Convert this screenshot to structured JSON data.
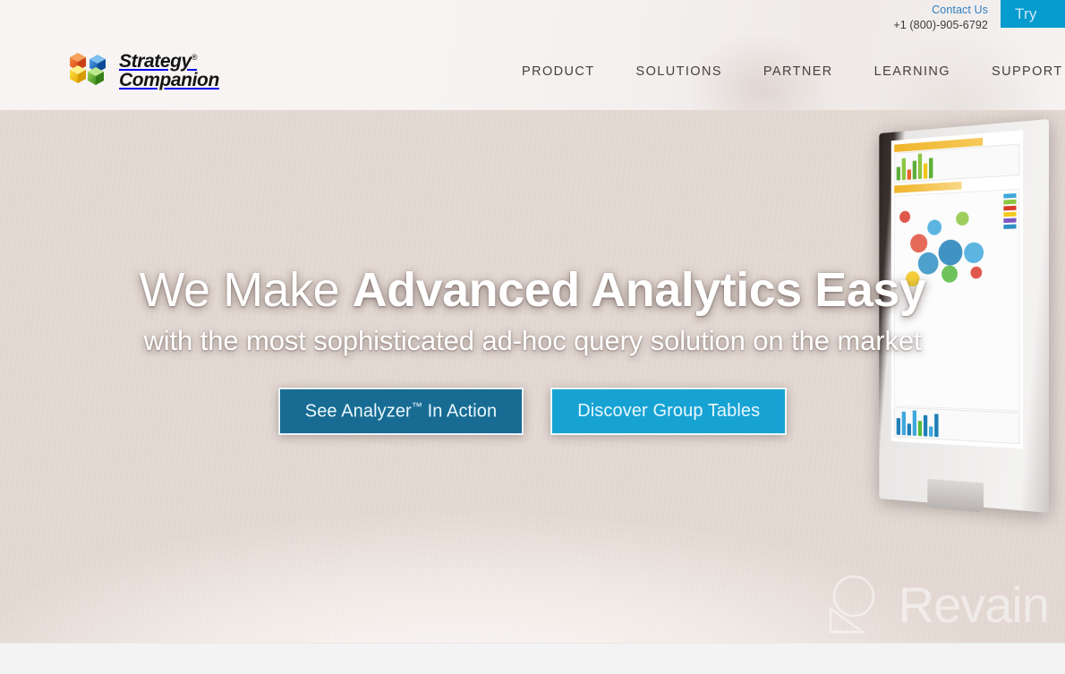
{
  "site": {
    "brand_name_line1": "Strategy",
    "brand_name_line2": "Companion",
    "registered_mark": "®"
  },
  "topbar": {
    "contact_label": "Contact Us",
    "phone": "+1 (800)-905-6792",
    "try_button_label": "Try"
  },
  "nav": {
    "items": [
      {
        "label": "PRODUCT"
      },
      {
        "label": "SOLUTIONS"
      },
      {
        "label": "PARTNER"
      },
      {
        "label": "LEARNING"
      },
      {
        "label": "SUPPORT"
      }
    ]
  },
  "hero": {
    "headline_light": "We Make ",
    "headline_bold": "Advanced Analytics Easy",
    "subhead": "with the most sophisticated ad-hoc query solution on the market",
    "cta_primary": "See Analyzer™ In Action",
    "cta_primary_text": "See Analyzer",
    "cta_primary_tm": "™",
    "cta_primary_tail": " In Action",
    "cta_secondary": "Discover Group Tables"
  },
  "watermark": {
    "text": "Revain"
  },
  "colors": {
    "accent_blue": "#069bce",
    "cta_primary_bg": "#186c93",
    "cta_secondary_bg": "#16a3d4",
    "link_blue": "#2f7fbf",
    "nav_text": "#45403e",
    "logo_orange": "#e8622a",
    "logo_blue": "#1b6fc4",
    "logo_yellow": "#f3c718",
    "logo_green": "#5fae3a"
  }
}
